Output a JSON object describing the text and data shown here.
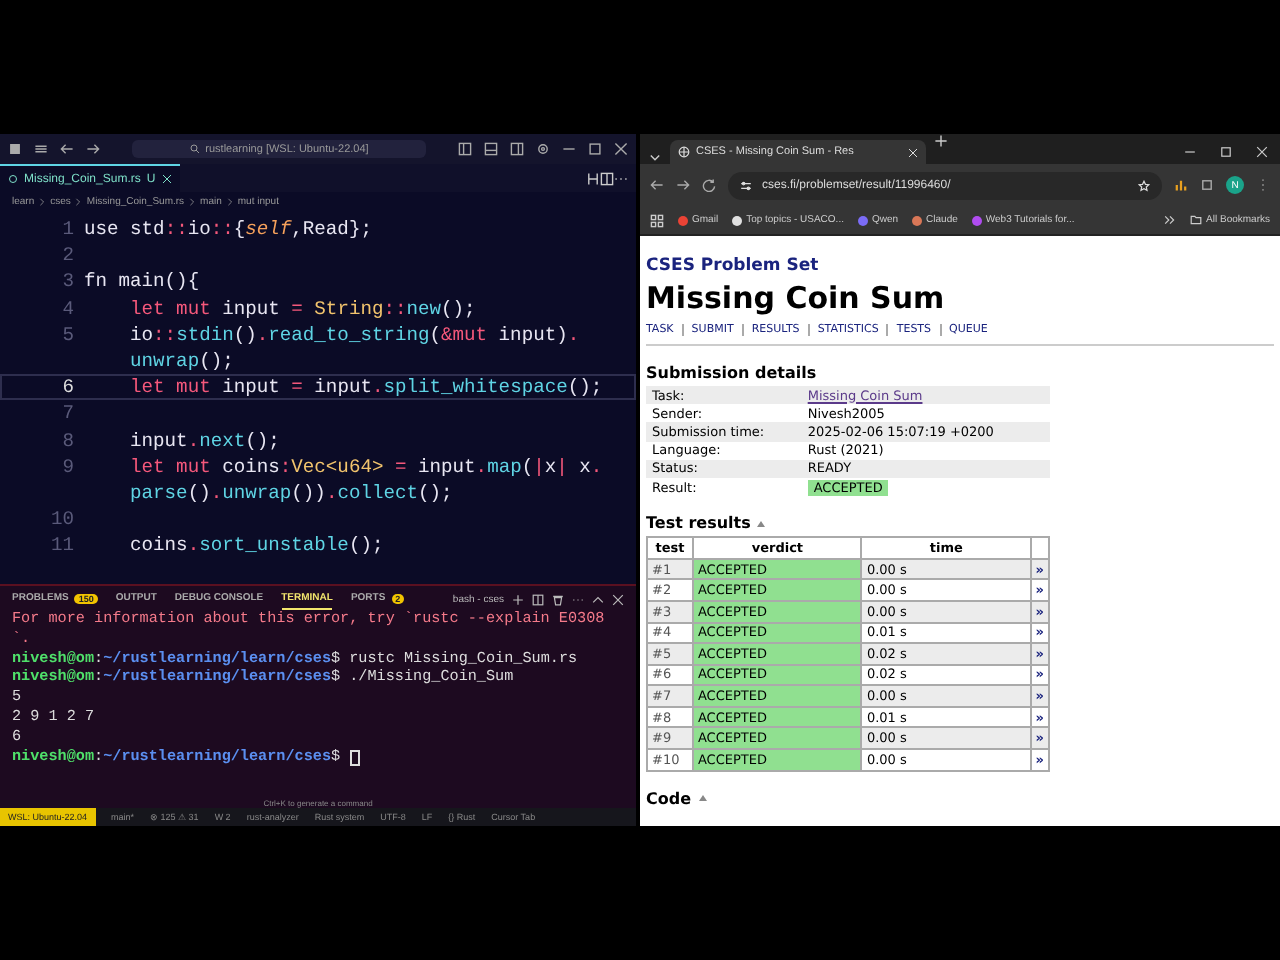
{
  "vscode": {
    "search": "rustlearning [WSL: Ubuntu-22.04]",
    "tab": {
      "label": "Missing_Coin_Sum.rs",
      "status": "U"
    },
    "breadcrumbs": [
      "learn",
      "cses",
      "Missing_Coin_Sum.rs",
      "main",
      "mut input"
    ],
    "code_rows": [
      {
        "number": "1",
        "current": false,
        "tokens": [
          {
            "t": "use std",
            "kind": "plain"
          },
          {
            "t": "::",
            "kind": "punct"
          },
          {
            "t": "io",
            "kind": "plain"
          },
          {
            "t": "::",
            "kind": "punct"
          },
          {
            "t": "{",
            "kind": "plain"
          },
          {
            "t": "self",
            "kind": "italic"
          },
          {
            "t": ",Read};",
            "kind": "plain"
          }
        ]
      },
      {
        "number": "2",
        "current": false
      },
      {
        "number": "3",
        "current": false,
        "tokens": [
          {
            "t": "fn main(){",
            "kind": "plain"
          }
        ]
      },
      {
        "number": "4",
        "current": false,
        "tokens": [
          {
            "t": "    let mut",
            "kind": "kw"
          },
          {
            "t": " input ",
            "kind": "plain"
          },
          {
            "t": "=",
            "kind": "punct"
          },
          {
            "t": " String",
            "kind": "type"
          },
          {
            "t": "::",
            "kind": "punct"
          },
          {
            "t": "new",
            "kind": "method"
          },
          {
            "t": "();",
            "kind": "plain"
          }
        ]
      },
      {
        "number": "5",
        "current": false,
        "tokens": [
          {
            "t": "    io",
            "kind": "plain"
          },
          {
            "t": "::",
            "kind": "punct"
          },
          {
            "t": "stdin",
            "kind": "method"
          },
          {
            "t": "()",
            "kind": "plain"
          },
          {
            "t": ".",
            "kind": "punct"
          },
          {
            "t": "read_to_string",
            "kind": "method"
          },
          {
            "t": "(",
            "kind": "plain"
          },
          {
            "t": "&mut",
            "kind": "kw"
          },
          {
            "t": " input)",
            "kind": "plain"
          },
          {
            "t": ".",
            "kind": "punct"
          }
        ]
      },
      {
        "current": false,
        "tokens": [
          {
            "t": "    unwrap",
            "kind": "method"
          },
          {
            "t": "();",
            "kind": "plain"
          }
        ]
      },
      {
        "number": "6",
        "current": true,
        "tokens": [
          {
            "t": "    let mut",
            "kind": "kw"
          },
          {
            "t": " input ",
            "kind": "plain"
          },
          {
            "t": "=",
            "kind": "punct"
          },
          {
            "t": " input",
            "kind": "plain"
          },
          {
            "t": ".",
            "kind": "punct"
          },
          {
            "t": "split_whitespace",
            "kind": "method"
          },
          {
            "t": "();",
            "kind": "plain"
          }
        ]
      },
      {
        "number": "7",
        "current": false
      },
      {
        "number": "8",
        "current": false,
        "tokens": [
          {
            "t": "    input",
            "kind": "plain"
          },
          {
            "t": ".",
            "kind": "punct"
          },
          {
            "t": "next",
            "kind": "method"
          },
          {
            "t": "();",
            "kind": "plain"
          }
        ]
      },
      {
        "number": "9",
        "current": false,
        "tokens": [
          {
            "t": "    let mut",
            "kind": "kw"
          },
          {
            "t": " coins",
            "kind": "plain"
          },
          {
            "t": ":",
            "kind": "punct"
          },
          {
            "t": "Vec<u64>",
            "kind": "type"
          },
          {
            "t": " = ",
            "kind": "punct"
          },
          {
            "t": "input",
            "kind": "plain"
          },
          {
            "t": ".",
            "kind": "punct"
          },
          {
            "t": "map",
            "kind": "method"
          },
          {
            "t": "(",
            "kind": "plain"
          },
          {
            "t": "|",
            "kind": "punct"
          },
          {
            "t": "x",
            "kind": "plain"
          },
          {
            "t": "|",
            "kind": "punct"
          },
          {
            "t": " x",
            "kind": "plain"
          },
          {
            "t": ".",
            "kind": "punct"
          }
        ]
      },
      {
        "current": false,
        "tokens": [
          {
            "t": "    parse",
            "kind": "method"
          },
          {
            "t": "()",
            "kind": "plain"
          },
          {
            "t": ".",
            "kind": "punct"
          },
          {
            "t": "unwrap",
            "kind": "method"
          },
          {
            "t": "())",
            "kind": "plain"
          },
          {
            "t": ".",
            "kind": "punct"
          },
          {
            "t": "collect",
            "kind": "method"
          },
          {
            "t": "();",
            "kind": "plain"
          }
        ]
      },
      {
        "number": "10",
        "current": false
      },
      {
        "number": "11",
        "current": false,
        "tokens": [
          {
            "t": "    coins",
            "kind": "plain"
          },
          {
            "t": ".",
            "kind": "punct"
          },
          {
            "t": "sort_unstable",
            "kind": "method"
          },
          {
            "t": "();",
            "kind": "plain"
          }
        ]
      }
    ],
    "panel_tabs": [
      {
        "label": "PROBLEMS",
        "badge": "150",
        "selected": false
      },
      {
        "label": "OUTPUT",
        "selected": false
      },
      {
        "label": "DEBUG CONSOLE",
        "selected": false
      },
      {
        "label": "TERMINAL",
        "selected": true
      },
      {
        "label": "PORTS",
        "badge": "2",
        "selected": false
      }
    ],
    "terminal_name": "bash - cses",
    "terminal": [
      {
        "kind": "error",
        "text": "For more information about this error, try `rustc --explain E0308"
      },
      {
        "kind": "error",
        "text": "`."
      },
      {
        "kind": "prompt",
        "user": "nivesh@om",
        "sep": ":",
        "path": "~/rustlearning/learn/cses",
        "command": "$ rustc Missing_Coin_Sum.rs"
      },
      {
        "kind": "prompt",
        "user": "nivesh@om",
        "sep": ":",
        "path": "~/rustlearning/learn/cses",
        "command": "$ ./Missing_Coin_Sum"
      },
      {
        "kind": "output",
        "text": "5"
      },
      {
        "kind": "output",
        "text": "2 9 1 2 7"
      },
      {
        "kind": "output",
        "text": "6"
      },
      {
        "kind": "prompt",
        "user": "nivesh@om",
        "sep": ":",
        "path": "~/rustlearning/learn/cses",
        "command": "$ ",
        "cursor": true
      }
    ],
    "terminal_hint": "Ctrl+K to generate a command",
    "status_remote": "WSL: Ubuntu-22.04",
    "status_items": [
      "main*",
      "⊗ 125 ⚠ 31",
      "W 2",
      "rust-analyzer",
      "Rust system",
      "UTF-8",
      "LF",
      "{} Rust",
      "Cursor Tab"
    ]
  },
  "browser": {
    "tab_title": "CSES - Missing Coin Sum - Res",
    "url": "cses.fi/problemset/result/11996460/",
    "profile": "N",
    "bookmarks": [
      {
        "label": "Gmail",
        "color": "#ea4335"
      },
      {
        "label": "Top topics - USACO...",
        "color": "#e0e0e0"
      },
      {
        "label": "Qwen",
        "color": "#7b6cf6"
      },
      {
        "label": "Claude",
        "color": "#d97757"
      },
      {
        "label": "Web3 Tutorials for...",
        "color": "#b04cf0"
      }
    ],
    "all_bookmarks": "All Bookmarks",
    "page": {
      "site": "CSES Problem Set",
      "title": "Missing Coin Sum",
      "nav": [
        "TASK",
        "SUBMIT",
        "RESULTS",
        "STATISTICS",
        "TESTS",
        "QUEUE"
      ],
      "details_heading": "Submission details",
      "details": [
        {
          "label": "Task:",
          "value": "Missing Coin Sum",
          "kind": "link"
        },
        {
          "label": "Sender:",
          "value": "Nivesh2005",
          "kind": "text"
        },
        {
          "label": "Submission time:",
          "value": "2025-02-06 15:07:19 +0200",
          "kind": "text"
        },
        {
          "label": "Language:",
          "value": "Rust (2021)",
          "kind": "text"
        },
        {
          "label": "Status:",
          "value": "READY",
          "kind": "text"
        },
        {
          "label": "Result:",
          "value": "ACCEPTED",
          "kind": "badge"
        }
      ],
      "tests_heading": "Test results",
      "test_columns": [
        "test",
        "verdict",
        "time"
      ],
      "tests": [
        {
          "test": "#1",
          "verdict": "ACCEPTED",
          "time": "0.00 s",
          "link": "»",
          "kind": "accepted"
        },
        {
          "test": "#2",
          "verdict": "ACCEPTED",
          "time": "0.00 s",
          "link": "»",
          "kind": "accepted"
        },
        {
          "test": "#3",
          "verdict": "ACCEPTED",
          "time": "0.00 s",
          "link": "»",
          "kind": "accepted"
        },
        {
          "test": "#4",
          "verdict": "ACCEPTED",
          "time": "0.01 s",
          "link": "»",
          "kind": "accepted"
        },
        {
          "test": "#5",
          "verdict": "ACCEPTED",
          "time": "0.02 s",
          "link": "»",
          "kind": "accepted"
        },
        {
          "test": "#6",
          "verdict": "ACCEPTED",
          "time": "0.02 s",
          "link": "»",
          "kind": "accepted"
        },
        {
          "test": "#7",
          "verdict": "ACCEPTED",
          "time": "0.00 s",
          "link": "»",
          "kind": "accepted"
        },
        {
          "test": "#8",
          "verdict": "ACCEPTED",
          "time": "0.01 s",
          "link": "»",
          "kind": "accepted"
        },
        {
          "test": "#9",
          "verdict": "ACCEPTED",
          "time": "0.00 s",
          "link": "»",
          "kind": "accepted"
        },
        {
          "test": "#10",
          "verdict": "ACCEPTED",
          "time": "0.00 s",
          "link": "»",
          "kind": "accepted"
        }
      ],
      "code_heading": "Code"
    }
  }
}
